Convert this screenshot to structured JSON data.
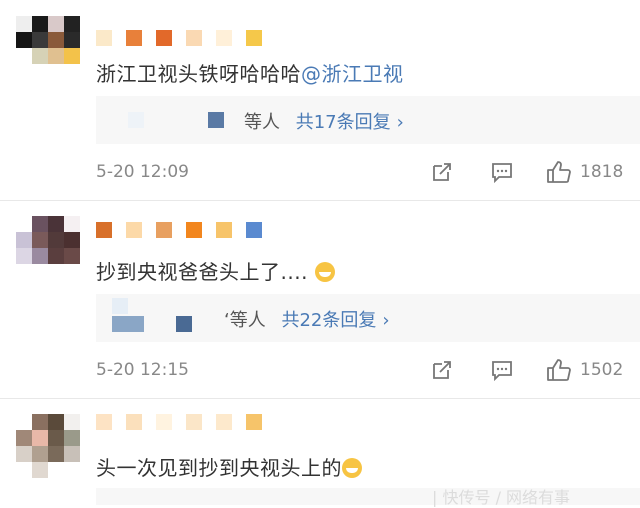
{
  "comments": [
    {
      "text": "浙江卫视头铁呀哈哈哈",
      "mention": "@浙江卫视",
      "reply_prefix": "等人",
      "reply_count": "共17条回复",
      "time": "5-20 12:09",
      "likes": "1818"
    },
    {
      "text": "抄到央视爸爸头上了....",
      "emoji": "laugh-emoji",
      "reply_prefix": "‘等人",
      "reply_count": "共22条回复",
      "time": "5-20 12:15",
      "likes": "1502"
    },
    {
      "text": "头一次见到抄到央视头上的",
      "emoji": "laugh-cry-emoji"
    }
  ],
  "icons": {
    "share": "share-icon",
    "comment": "comment-icon",
    "like": "thumbs-up-icon",
    "chevron": "chevron-right-icon"
  },
  "colors": {
    "link": "#4a7ab5",
    "reply_bg": "#f7f7f7",
    "meta": "#888888"
  }
}
